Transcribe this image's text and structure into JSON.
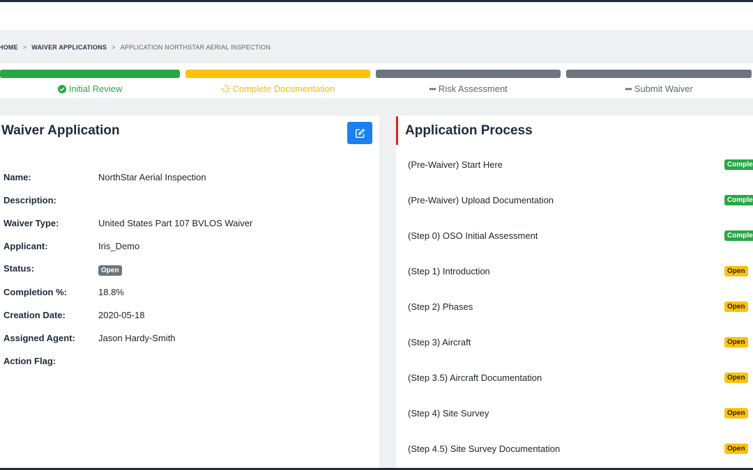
{
  "breadcrumb": {
    "home": "HOME",
    "sep1": ">",
    "waiver_applications": "WAIVER APPLICATIONS",
    "sep2": ">",
    "current": "APPLICATION NORTHSTAR AERIAL INSPECTION"
  },
  "stepper": {
    "steps": [
      {
        "label": "Initial Review",
        "state": "complete",
        "color": "#28a745",
        "icon": "check-circle-icon"
      },
      {
        "label": "Complete Documentation",
        "state": "in-progress",
        "color": "#ffc107",
        "icon": "spinner-icon"
      },
      {
        "label": "Risk Assessment",
        "state": "pending",
        "color": "#6c757d",
        "icon": "dots-icon",
        "prefix": "•••"
      },
      {
        "label": "Submit Waiver",
        "state": "pending",
        "color": "#6c757d",
        "icon": "dots-icon",
        "prefix": "•••"
      }
    ]
  },
  "application": {
    "title": "Waiver Application",
    "edit_icon": "edit-icon",
    "fields": [
      {
        "label": "Name:",
        "value": "NorthStar Aerial Inspection"
      },
      {
        "label": "Description:",
        "value": ""
      },
      {
        "label": "Waiver Type:",
        "value": "United States Part 107 BVLOS Waiver"
      },
      {
        "label": "Applicant:",
        "value": "Iris_Demo"
      },
      {
        "label": "Status:",
        "value": "Open"
      },
      {
        "label": "Completion %:",
        "value": "18.8%"
      },
      {
        "label": "Creation Date:",
        "value": "2020-05-18"
      },
      {
        "label": "Assigned Agent:",
        "value": "Jason Hardy-Smith"
      },
      {
        "label": "Action Flag:",
        "value": ""
      }
    ]
  },
  "process": {
    "title": "Application Process",
    "accent_color": "#e51c23",
    "items": [
      {
        "label": "(Pre-Waiver) Start Here",
        "status": "Comple"
      },
      {
        "label": "(Pre-Waiver) Upload Documentation",
        "status": "Comple"
      },
      {
        "label": "(Step 0) OSO Initial Assessment",
        "status": "Comple"
      },
      {
        "label": "(Step 1) Introduction",
        "status": "Open"
      },
      {
        "label": "(Step 2) Phases",
        "status": "Open"
      },
      {
        "label": "(Step 3) Aircraft",
        "status": "Open"
      },
      {
        "label": "(Step 3.5) Aircraft Documentation",
        "status": "Open"
      },
      {
        "label": "(Step 4) Site Survey",
        "status": "Open"
      },
      {
        "label": "(Step 4.5) Site Survey Documentation",
        "status": "Open"
      }
    ]
  }
}
